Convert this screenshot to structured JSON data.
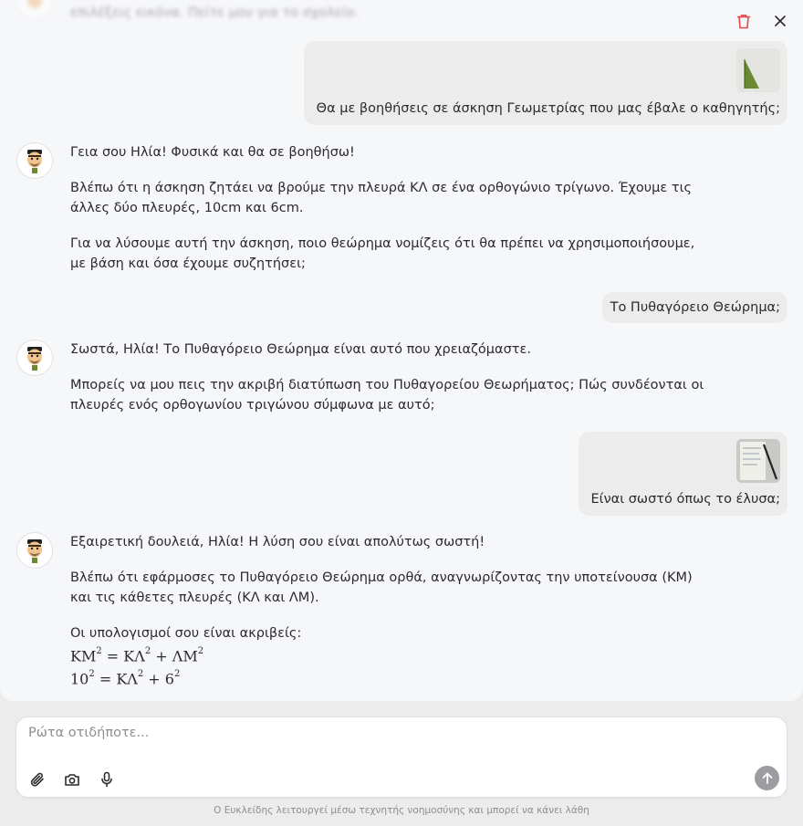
{
  "header": {
    "delete_icon": "trash-icon",
    "close_icon": "close-icon"
  },
  "faded_message": {
    "text": "επιλέξεις εικόνα. Πείτε μου για το σχολείο."
  },
  "messages": [
    {
      "role": "user",
      "has_image": true,
      "image_kind": "triangle-photo",
      "text": "Θα με βοηθήσεις σε άσκηση Γεωμετρίας που μας έβαλε ο καθηγητής;"
    },
    {
      "role": "assistant",
      "paragraphs": [
        "Γεια σου Ηλία! Φυσικά και θα σε βοηθήσω!",
        "Βλέπω ότι η άσκηση ζητάει να βρούμε την πλευρά ΚΛ σε ένα ορθογώνιο τρίγωνο. Έχουμε τις άλλες δύο πλευρές, 10cm και 6cm.",
        "Για να λύσουμε αυτή την άσκηση, ποιο θεώρημα νομίζεις ότι θα πρέπει να χρησιμοποιήσουμε, με βάση και όσα έχουμε συζητήσει;"
      ]
    },
    {
      "role": "user",
      "has_image": false,
      "text": "Το Πυθαγόρειο Θεώρημα;"
    },
    {
      "role": "assistant",
      "paragraphs": [
        "Σωστά, Ηλία! Το Πυθαγόρειο Θεώρημα είναι αυτό που χρειαζόμαστε.",
        "Μπορείς να μου πεις την ακριβή διατύπωση του Πυθαγορείου Θεωρήματος; Πώς συνδέονται οι πλευρές ενός ορθογωνίου τριγώνου σύμφωνα με αυτό;"
      ]
    },
    {
      "role": "user",
      "has_image": true,
      "image_kind": "notebook-photo",
      "text": "Είναι σωστό όπως το έλυσα;"
    },
    {
      "role": "assistant",
      "paragraphs": [
        "Εξαιρετική δουλειά, Ηλία! Η λύση σου είναι απολύτως σωστή!",
        "Βλέπω ότι εφάρμοσες το Πυθαγόρειο Θεώρημα ορθά, αναγνωρίζοντας την υποτείνουσα (ΚΜ) και τις κάθετες πλευρές (ΚΛ και ΛΜ).",
        "Οι υπολογισμοί σου είναι ακριβείς:"
      ],
      "math": [
        {
          "lhs": "ΚΜ",
          "lhs_exp": "2",
          "eq": " = ",
          "t1": "ΚΛ",
          "t1_exp": "2",
          "plus": " + ",
          "t2": "ΛΜ",
          "t2_exp": "2"
        },
        {
          "lhs": "10",
          "lhs_exp": "2",
          "eq": " = ",
          "t1": "ΚΛ",
          "t1_exp": "2",
          "plus": " + ",
          "t2": "6",
          "t2_exp": "2"
        }
      ]
    }
  ],
  "composer": {
    "placeholder": "Ρώτα οτιδήποτε...",
    "tools": [
      "paperclip-icon",
      "camera-icon",
      "microphone-icon"
    ],
    "send_icon": "arrow-up-icon"
  },
  "disclaimer": "Ο Ευκλείδης λειτουργεί μέσω τεχνητής νοημοσύνης και μπορεί να κάνει λάθη",
  "colors": {
    "delete": "#e5484d",
    "send_disabled": "#9d9da1",
    "user_bubble": "#ececed"
  }
}
